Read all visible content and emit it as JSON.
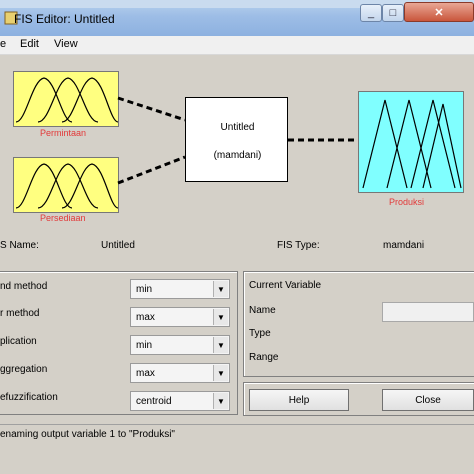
{
  "window": {
    "title": "FIS Editor: Untitled"
  },
  "menus": [
    "e",
    "Edit",
    "View"
  ],
  "diagram": {
    "inputs": [
      {
        "label": "Permintaan"
      },
      {
        "label": "Persediaan"
      }
    ],
    "system": {
      "name": "Untitled",
      "type": "(mamdani)"
    },
    "output": {
      "label": "Produksi"
    }
  },
  "info": {
    "fis_name_label": "S Name:",
    "fis_name_value": "Untitled",
    "fis_type_label": "FIS Type:",
    "fis_type_value": "mamdani"
  },
  "methods": [
    {
      "label": "nd method",
      "value": "min"
    },
    {
      "label": "r method",
      "value": "max"
    },
    {
      "label": "plication",
      "value": "min"
    },
    {
      "label": "ggregation",
      "value": "max"
    },
    {
      "label": "efuzzification",
      "value": "centroid"
    }
  ],
  "current_variable": {
    "title": "Current Variable",
    "name_label": "Name",
    "name_value": "",
    "type_label": "Type",
    "range_label": "Range"
  },
  "buttons": {
    "help": "Help",
    "close": "Close"
  },
  "status": "enaming output variable 1 to \"Produksi\"",
  "colors": {
    "input_mf": "#ffff80",
    "output_mf": "#80ffff",
    "label_red": "#e23a3a"
  }
}
